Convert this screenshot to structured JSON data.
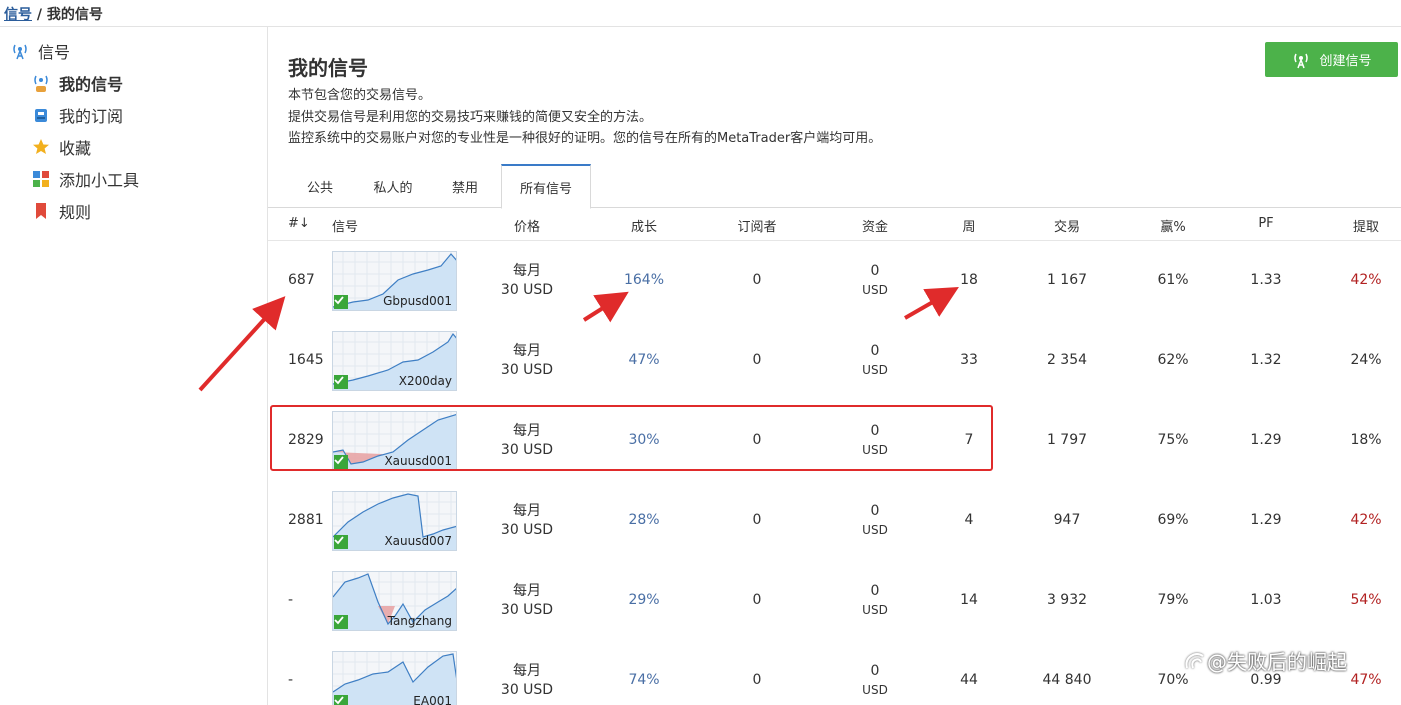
{
  "breadcrumb": {
    "root": "信号",
    "sep": " / ",
    "current": "我的信号"
  },
  "sidebar": {
    "items": [
      {
        "label": "信号",
        "icon": "antenna-icon"
      },
      {
        "label": "我的信号",
        "icon": "signal-user-icon"
      },
      {
        "label": "我的订阅",
        "icon": "robot-icon"
      },
      {
        "label": "收藏",
        "icon": "star-icon"
      },
      {
        "label": "添加小工具",
        "icon": "widgets-icon"
      },
      {
        "label": "规则",
        "icon": "bookmark-icon"
      }
    ]
  },
  "main": {
    "title": "我的信号",
    "desc": [
      "本节包含您的交易信号。",
      "提供交易信号是利用您的交易技巧来赚钱的简便又安全的方法。",
      "监控系统中的交易账户对您的专业性是一种很好的证明。您的信号在所有的MetaTrader客户端均可用。"
    ],
    "create_button": "创建信号",
    "tabs": [
      "公共",
      "私人的",
      "禁用",
      "所有信号"
    ],
    "active_tab": "所有信号"
  },
  "table": {
    "headers": [
      "#↓",
      "信号",
      "价格",
      "成长",
      "订阅者",
      "资金",
      "周",
      "交易",
      "赢%",
      "PF",
      "提取"
    ],
    "rows": [
      {
        "rank": "687",
        "name": "Gbpusd001",
        "price1": "每月",
        "price2": "30 USD",
        "growth": "164%",
        "subs": "0",
        "funds": "0",
        "funds_unit": "USD",
        "weeks": "18",
        "trades": "1 167",
        "win": "61%",
        "pf": "1.33",
        "dd": "42%",
        "dd_red": true
      },
      {
        "rank": "1645",
        "name": "X200day",
        "price1": "每月",
        "price2": "30 USD",
        "growth": "47%",
        "subs": "0",
        "funds": "0",
        "funds_unit": "USD",
        "weeks": "33",
        "trades": "2 354",
        "win": "62%",
        "pf": "1.32",
        "dd": "24%",
        "dd_red": false
      },
      {
        "rank": "2829",
        "name": "Xauusd001",
        "price1": "每月",
        "price2": "30 USD",
        "growth": "30%",
        "subs": "0",
        "funds": "0",
        "funds_unit": "USD",
        "weeks": "7",
        "trades": "1 797",
        "win": "75%",
        "pf": "1.29",
        "dd": "18%",
        "dd_red": false
      },
      {
        "rank": "2881",
        "name": "Xauusd007",
        "price1": "每月",
        "price2": "30 USD",
        "growth": "28%",
        "subs": "0",
        "funds": "0",
        "funds_unit": "USD",
        "weeks": "4",
        "trades": "947",
        "win": "69%",
        "pf": "1.29",
        "dd": "42%",
        "dd_red": true
      },
      {
        "rank": "-",
        "name": "Tangzhang",
        "price1": "每月",
        "price2": "30 USD",
        "growth": "29%",
        "subs": "0",
        "funds": "0",
        "funds_unit": "USD",
        "weeks": "14",
        "trades": "3 932",
        "win": "79%",
        "pf": "1.03",
        "dd": "54%",
        "dd_red": true
      },
      {
        "rank": "-",
        "name": "EA001",
        "price1": "每月",
        "price2": "30 USD",
        "growth": "74%",
        "subs": "0",
        "funds": "0",
        "funds_unit": "USD",
        "weeks": "44",
        "trades": "44 840",
        "win": "70%",
        "pf": "0.99",
        "dd": "47%",
        "dd_red": true
      }
    ]
  },
  "watermark": "@失败后的崛起",
  "colors": {
    "accent_green": "#4cb24a",
    "link_blue": "#2b5d9b",
    "growth_blue": "#4a6fa5",
    "drawdown_red": "#b22222",
    "annotation_red": "#e02b2b"
  }
}
